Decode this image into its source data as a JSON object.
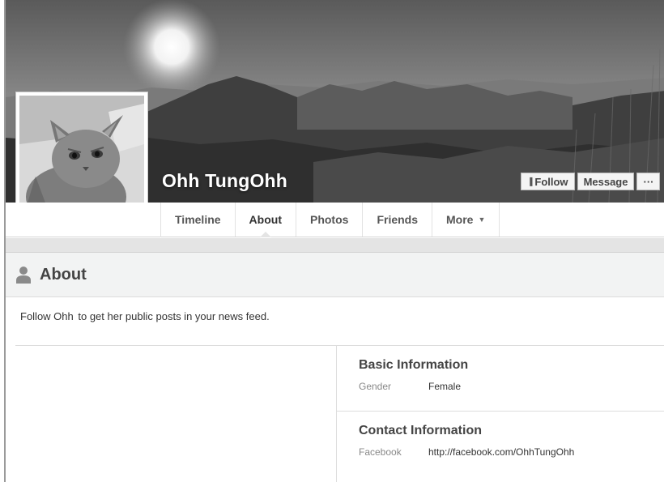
{
  "profile": {
    "name": "Ohh TungOhh"
  },
  "cover_actions": {
    "follow_label": "Follow",
    "message_label": "Message",
    "more_label": "···"
  },
  "tabs": [
    {
      "label": "Timeline"
    },
    {
      "label": "About"
    },
    {
      "label": "Photos"
    },
    {
      "label": "Friends"
    },
    {
      "label": "More"
    }
  ],
  "about": {
    "title": "About",
    "follow_name": "Follow Ohh",
    "follow_rest": "to get her public posts in your news feed.",
    "basic_info": {
      "title": "Basic Information",
      "gender_label": "Gender",
      "gender_value": "Female"
    },
    "contact_info": {
      "title": "Contact Information",
      "facebook_label": "Facebook",
      "facebook_value": "http://facebook.com/OhhTungOhh"
    }
  },
  "icons": {
    "follow": "rss-icon",
    "more_tab": "caret-down-icon",
    "about": "person-icon"
  }
}
